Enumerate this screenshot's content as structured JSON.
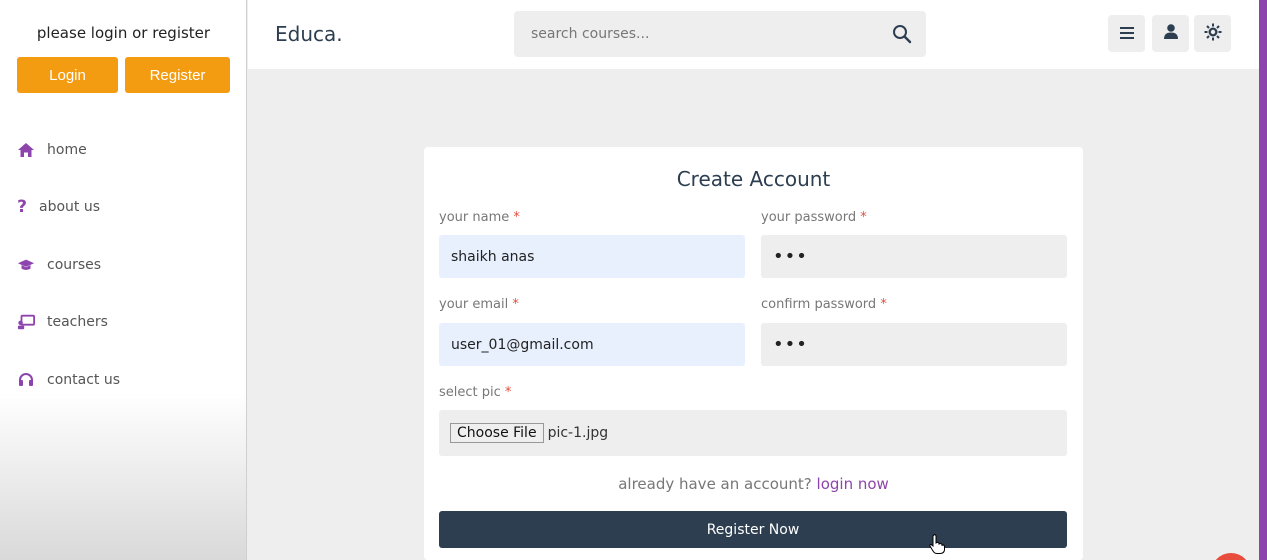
{
  "sidebar": {
    "prompt": "please login or register",
    "login_label": "Login",
    "register_label": "Register",
    "items": [
      {
        "label": "home",
        "icon": "home-icon"
      },
      {
        "label": "about us",
        "icon": "question-icon"
      },
      {
        "label": "courses",
        "icon": "graduation-cap-icon"
      },
      {
        "label": "teachers",
        "icon": "teacher-icon"
      },
      {
        "label": "contact us",
        "icon": "headset-icon"
      }
    ]
  },
  "header": {
    "logo": "Educa.",
    "search_placeholder": "search courses..."
  },
  "form": {
    "title": "Create Account",
    "name_label": "your name",
    "name_value": "shaikh anas",
    "password_label": "your password",
    "password_value": "•••",
    "email_label": "your email",
    "email_value": "user_01@gmail.com",
    "confirm_label": "confirm password",
    "confirm_value": "•••",
    "pic_label": "select pic",
    "choose_file_label": "Choose File",
    "file_name": "pic-1.jpg",
    "already_text": "already have an account?",
    "login_link": "login now",
    "submit_label": "Register Now",
    "required_mark": "*"
  },
  "colors": {
    "accent": "#f39c12",
    "purple": "#8e44ad",
    "dark": "#2c3e50",
    "required": "#e74c3c"
  }
}
